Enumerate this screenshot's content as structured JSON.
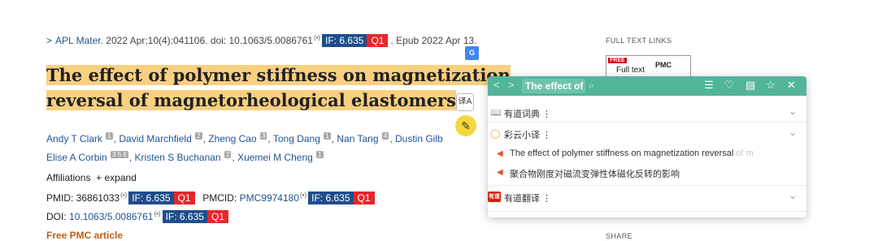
{
  "citation": {
    "journal": "APL Mater.",
    "details": " 2022 Apr;10(4):041106. doi: 10.1063/5.0086761",
    "signal": "(•)",
    "impact_factor": "IF: 6.635",
    "quartile": "Q1",
    "epub": ". Epub 2022 Apr 13."
  },
  "article": {
    "title_line1": "The effect of polymer stiffness on magnetization",
    "title_line2": "reversal of magnetorheological elastomers"
  },
  "authors": [
    {
      "name": "Andy T Clark",
      "aff": "1",
      "sep": ", "
    },
    {
      "name": "David Marchfield",
      "aff": "2",
      "sep": ", "
    },
    {
      "name": "Zheng Cao",
      "aff": "3",
      "sep": ", "
    },
    {
      "name": "Tong Dang",
      "aff": "1",
      "sep": ", "
    },
    {
      "name": "Nan Tang",
      "aff": "4",
      "sep": ", "
    },
    {
      "name": "Dustin Gilb",
      "aff": "",
      "sep": ""
    },
    {
      "name": "Elise A Corbin",
      "aff": "3 5 6",
      "sep": ", "
    },
    {
      "name": "Kristen S Buchanan",
      "aff": "2",
      "sep": ", "
    },
    {
      "name": "Xuemei M Cheng",
      "aff": "1",
      "sep": ""
    }
  ],
  "affiliations": {
    "label": "Affiliations",
    "expand": "+ expand"
  },
  "ids": {
    "pmid_label": "PMID: 36861033",
    "pmcid_label": "PMCID: ",
    "pmcid_value": "PMC9974180",
    "doi_label": "DOI: ",
    "doi_value": "10.1063/5.0086761",
    "signal": "(•)",
    "impact_factor": "IF: 6.635",
    "quartile": "Q1"
  },
  "free_pmc": "Free PMC article",
  "right_column": {
    "full_text_links": "FULL TEXT LINKS",
    "badge_free": "FREE",
    "badge_full_text": "Full text",
    "badge_pmc": "PMC",
    "share": "SHARE"
  },
  "icons": {
    "google_translate": "G",
    "translate_tool": "译A",
    "highlighter": "✎"
  },
  "popup": {
    "query": "The effect of",
    "youdao_dict": "有道词典 ⋮",
    "caiyun": "彩云小译 ⋮",
    "source_text": "The effect of polymer stiffness on magnetization reversal",
    "source_fade": " of m",
    "translation": "聚合物刚度对磁流变弹性体磁化反转的影响",
    "youdao_translate": "有道翻译 ⋮",
    "youdao_logo": "有道",
    "colors": {
      "header": "#52b59a",
      "speaker": "#e5532d"
    }
  }
}
